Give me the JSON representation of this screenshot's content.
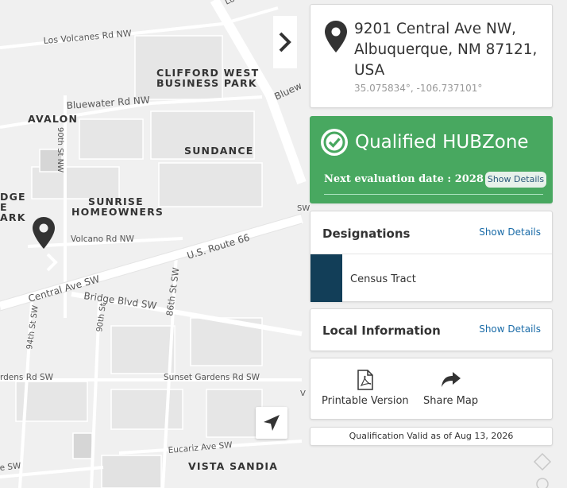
{
  "map": {
    "streets": {
      "los_volcanes": "Los Volcanes Rd NW",
      "bluewater": "Bluewater Rd NW",
      "blue_partial": "Bluew",
      "ninetieth": "90th St NW",
      "volcano": "Volcano Rd NW",
      "route66": "U.S. Route 66",
      "central": "Central Ave SW",
      "bridge": "Bridge Blvd SW",
      "ninetieth_sw": "90th St",
      "ninety_fourth": "94th St SW",
      "eighty_sixth": "86th St SW",
      "gardens": "rdens Rd SW",
      "sunset_gardens": "Sunset Gardens Rd SW",
      "eucariz": "Eucariz Ave SW",
      "e_sw": "e SW",
      "sw_partial": "SW",
      "v_partial": "V",
      "top_partial": "Lou"
    },
    "areas": {
      "clifford_1": "CLIFFORD WEST",
      "clifford_2": "BUSINESS PARK",
      "avalon": "AVALON",
      "sundance": "SUNDANCE",
      "dge_1": "DGE",
      "dge_2": "E",
      "dge_3": "ARK",
      "sunrise_1": "SUNRISE",
      "sunrise_2": "HOMEOWNERS",
      "vista_sandia": "VISTA SANDIA"
    }
  },
  "address": {
    "line1": "9201 Central Ave NW,",
    "line2": "Albuquerque, NM 87121,",
    "line3": "USA",
    "coords": "35.075834°, -106.737101°"
  },
  "status": {
    "title": "Qualified HUBZone",
    "next_eval": "Next evaluation date : 2028",
    "details_label": "Show Details",
    "color": "#48a860"
  },
  "designations": {
    "title": "Designations",
    "link": "Show Details",
    "items": [
      {
        "label": "Census Tract",
        "color": "#123e58"
      }
    ]
  },
  "local_info": {
    "title": "Local Information",
    "link": "Show Details"
  },
  "actions": {
    "printable": "Printable Version",
    "share": "Share Map"
  },
  "validity": "Qualification Valid as of Aug 13, 2026"
}
